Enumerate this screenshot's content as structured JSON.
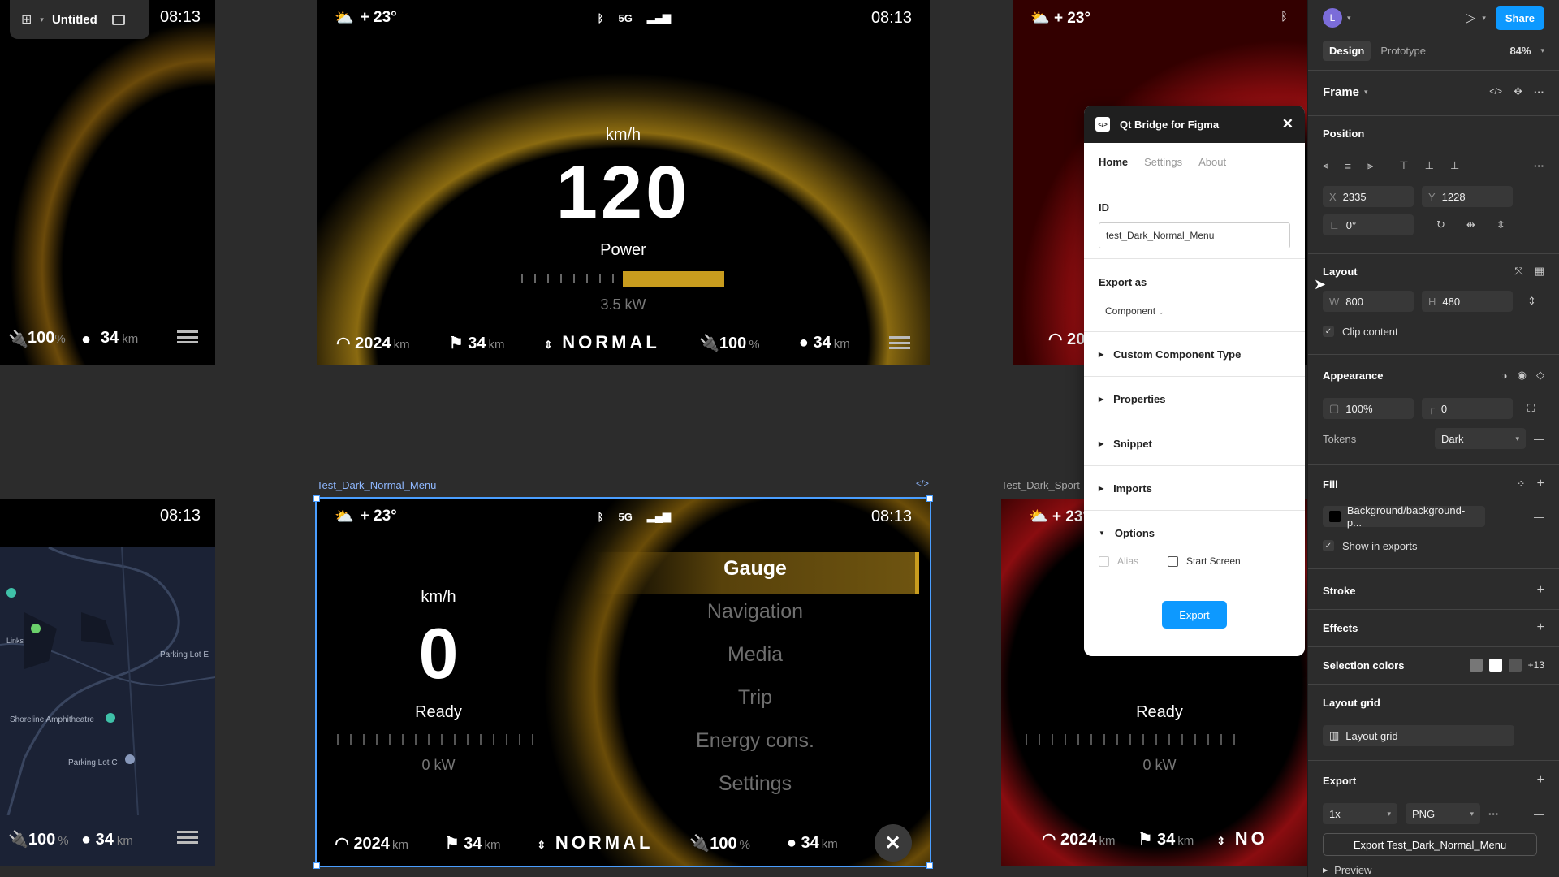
{
  "toolbar": {
    "file_name": "Untitled"
  },
  "frames": {
    "top_left": {
      "time": "08:13",
      "battery": "100",
      "battery_unit": "%",
      "range": "34",
      "range_unit": "km"
    },
    "top_center": {
      "weather": "+ 23°",
      "net": "5G",
      "time": "08:13",
      "speed_unit": "km/h",
      "speed": "120",
      "power_label": "Power",
      "power_value": "3.5 kW",
      "power_level": 0.5,
      "odometer": "2024",
      "odometer_unit": "km",
      "trip": "34",
      "trip_unit": "km",
      "mode": "NORMAL",
      "battery": "100",
      "battery_unit": "%",
      "range": "34",
      "range_unit": "km"
    },
    "top_right": {
      "weather": "+ 23°",
      "odometer_partial": "20"
    },
    "bottom_left": {
      "time": "08:13",
      "battery": "100",
      "battery_unit": "%",
      "range": "34",
      "range_unit": "km",
      "map_labels": [
        "Shoreline Amphitheatre",
        "Parking Lot C",
        "Parking Lot E",
        "Links"
      ]
    },
    "bottom_center": {
      "label": "Test_Dark_Normal_Menu",
      "code_glyph": "</>",
      "weather": "+ 23°",
      "net": "5G",
      "time": "08:13",
      "speed_unit": "km/h",
      "speed": "0",
      "ready": "Ready",
      "power_value": "0 kW",
      "menu": [
        "Gauge",
        "Navigation",
        "Media",
        "Trip",
        "Energy cons.",
        "Settings"
      ],
      "odometer": "2024",
      "odometer_unit": "km",
      "trip": "34",
      "trip_unit": "km",
      "mode": "NORMAL",
      "battery": "100",
      "battery_unit": "%",
      "range": "34",
      "range_unit": "km"
    },
    "bottom_right": {
      "label": "Test_Dark_Sport",
      "weather": "+ 23°",
      "ready": "Ready",
      "power_value": "0 kW",
      "odometer": "2024",
      "odometer_unit": "km",
      "trip": "34",
      "trip_unit": "km",
      "mode": "NO"
    }
  },
  "plugin": {
    "title": "Qt Bridge for Figma",
    "tabs": [
      "Home",
      "Settings",
      "About"
    ],
    "id_label": "ID",
    "id_value": "test_Dark_Normal_Menu",
    "export_as_label": "Export as",
    "export_as_value": "Component",
    "sections": [
      "Custom Component Type",
      "Properties",
      "Snippet",
      "Imports",
      "Options"
    ],
    "opt_alias": "Alias",
    "opt_start": "Start Screen",
    "export_btn": "Export"
  },
  "panel": {
    "avatar": "L",
    "share": "Share",
    "tab_design": "Design",
    "tab_prototype": "Prototype",
    "zoom": "84%",
    "frame_title": "Frame",
    "position": "Position",
    "x_label": "X",
    "x": "2335",
    "y_label": "Y",
    "y": "1228",
    "rotation": "0°",
    "layout": "Layout",
    "w_label": "W",
    "w": "800",
    "h_label": "H",
    "h": "480",
    "clip": "Clip content",
    "appearance": "Appearance",
    "opacity": "100%",
    "radius": "0",
    "tokens": "Tokens",
    "tokens_value": "Dark",
    "fill": "Fill",
    "fill_value": "Background/background-p...",
    "show_exports": "Show in exports",
    "stroke": "Stroke",
    "effects": "Effects",
    "sel_colors": "Selection colors",
    "sel_more": "+13",
    "layout_grid": "Layout grid",
    "layout_grid_item": "Layout grid",
    "export": "Export",
    "scale": "1x",
    "format": "PNG",
    "export_btn": "Export Test_Dark_Normal_Menu",
    "preview": "Preview"
  },
  "colors": {
    "accent": "#d4a72c",
    "figma_blue": "#0d99ff",
    "selection": "#4a9eff"
  }
}
